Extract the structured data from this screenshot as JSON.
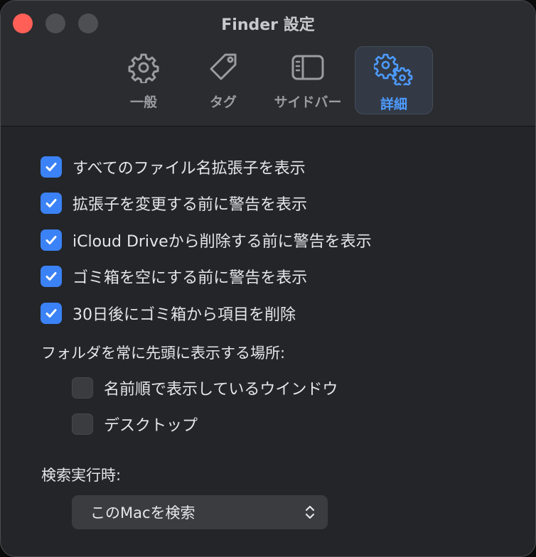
{
  "window": {
    "title": "Finder 設定"
  },
  "tabs": [
    {
      "label": "一般",
      "icon": "gear-icon",
      "active": false
    },
    {
      "label": "タグ",
      "icon": "tag-icon",
      "active": false
    },
    {
      "label": "サイドバー",
      "icon": "sidebar-icon",
      "active": false
    },
    {
      "label": "詳細",
      "icon": "gears-icon",
      "active": true
    }
  ],
  "options": [
    {
      "label": "すべてのファイル名拡張子を表示",
      "checked": true
    },
    {
      "label": "拡張子を変更する前に警告を表示",
      "checked": true
    },
    {
      "label": "iCloud Driveから削除する前に警告を表示",
      "checked": true
    },
    {
      "label": "ゴミ箱を空にする前に警告を表示",
      "checked": true
    },
    {
      "label": "30日後にゴミ箱から項目を削除",
      "checked": true
    }
  ],
  "folders_first": {
    "label": "フォルダを常に先頭に表示する場所:",
    "options": [
      {
        "label": "名前順で表示しているウインドウ",
        "checked": false
      },
      {
        "label": "デスクトップ",
        "checked": false
      }
    ]
  },
  "search": {
    "label": "検索実行時:",
    "selected": "このMacを検索"
  },
  "colors": {
    "accent": "#3b82f6",
    "active_tab_text": "#4d9bff",
    "close_button": "#ff5f57"
  }
}
